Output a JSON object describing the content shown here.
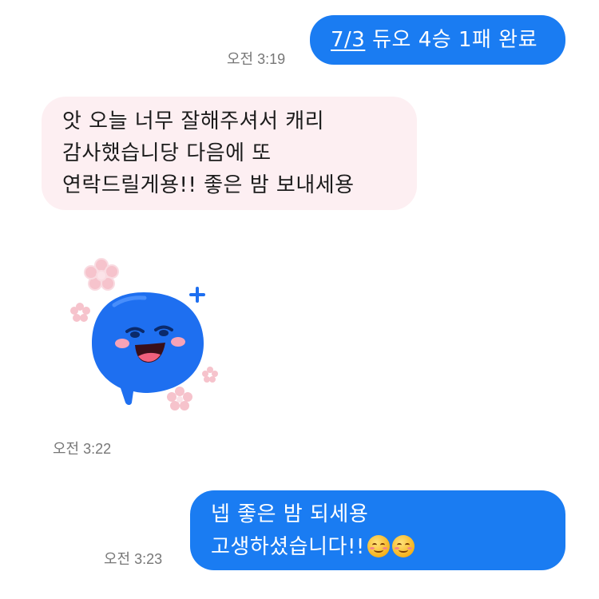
{
  "messages": [
    {
      "direction": "outgoing",
      "time": "오전 3:19",
      "link_text": "7/3",
      "text_after_link": " 듀오 4승 1패 완료"
    },
    {
      "direction": "incoming",
      "lines": [
        "앗 오늘 너무 잘해주셔서  캐리",
        "감사했습니당 다음에 또",
        "연락드릴게용!! 좋은 밤 보내세용"
      ]
    },
    {
      "direction": "incoming",
      "type": "sticker",
      "sticker": "blue-smiling-chat-bubble-sticker",
      "time": "오전 3:22"
    },
    {
      "direction": "outgoing",
      "time": "오전 3:23",
      "lines": [
        "넵 좋은 밤 되세용",
        "고생하셨습니다!!"
      ],
      "emojis": [
        "smiling-face-with-blush-icon",
        "smiling-face-with-blush-icon"
      ]
    }
  ],
  "colors": {
    "outgoing_bubble": "#1a7cf2",
    "incoming_bubble": "#fdeff2",
    "sticker_blue": "#1e6ff0",
    "sticker_flower": "#f7c6cf"
  }
}
